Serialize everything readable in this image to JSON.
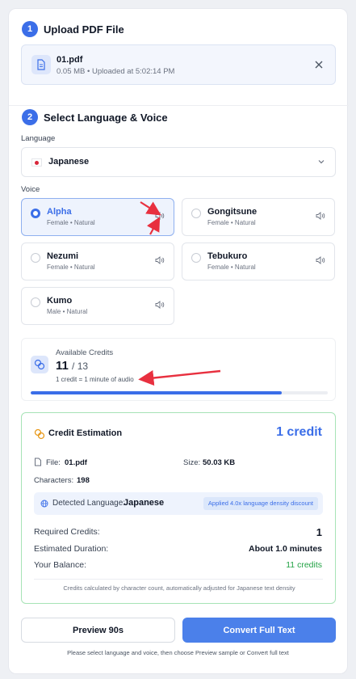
{
  "step1": {
    "number": "1",
    "title": "Upload PDF File"
  },
  "file": {
    "name": "01.pdf",
    "meta": "0.05 MB • Uploaded at 5:02:14 PM",
    "icon": "document-icon",
    "close_icon": "close-icon"
  },
  "step2": {
    "number": "2",
    "title": "Select Language & Voice"
  },
  "language": {
    "label": "Language",
    "selected": "Japanese",
    "flag_icon": "japan-flag-icon",
    "chevron_icon": "chevron-down-icon"
  },
  "voice": {
    "label": "Voice",
    "options": [
      {
        "name": "Alpha",
        "desc": "Female • Natural",
        "selected": true
      },
      {
        "name": "Gongitsune",
        "desc": "Female • Natural",
        "selected": false
      },
      {
        "name": "Nezumi",
        "desc": "Female • Natural",
        "selected": false
      },
      {
        "name": "Tebukuro",
        "desc": "Female • Natural",
        "selected": false
      },
      {
        "name": "Kumo",
        "desc": "Male • Natural",
        "selected": false
      }
    ]
  },
  "credits": {
    "label": "Available Credits",
    "available": "11",
    "total": "/ 13",
    "note": "1 credit = 1 minute of audio",
    "progress": 0.846,
    "accent": "#3b6ee8"
  },
  "estimation": {
    "title": "Credit Estimation",
    "big": "1 credit",
    "file_label": "File:",
    "file_value": "01.pdf",
    "size_label": "Size:",
    "size_value": "50.03 KB",
    "chars_label": "Characters:",
    "chars_value": "198",
    "detected_label": "Detected Language:",
    "detected_value": "Japanese",
    "discount_badge": "Applied 4.0x language density discount",
    "required_label": "Required Credits:",
    "required_value": "1",
    "duration_label": "Estimated Duration:",
    "duration_value": "About 1.0 minutes",
    "balance_label": "Your Balance:",
    "balance_value": "11 credits",
    "footer": "Credits calculated by character count, automatically adjusted for Japanese text density",
    "border_color": "#a7e3b6"
  },
  "actions": {
    "preview": "Preview 90s",
    "convert": "Convert Full Text",
    "hint": "Please select language and voice, then choose Preview sample or Convert full text"
  },
  "annotation_color": "#e8303f"
}
